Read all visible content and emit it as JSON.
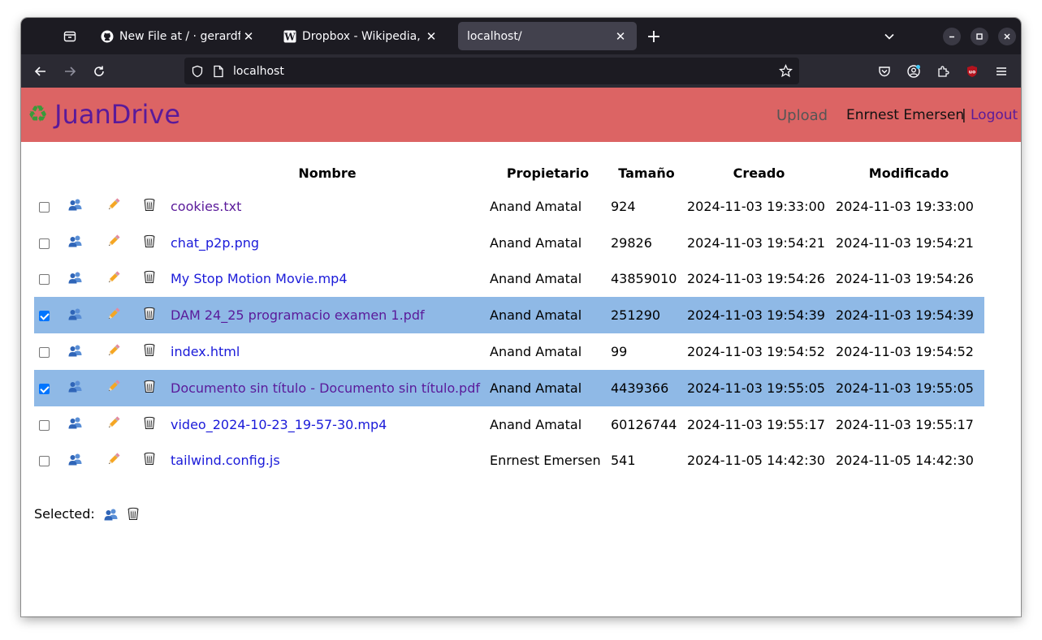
{
  "browser": {
    "tabs": [
      {
        "title": "New File at / · gerardfp/…",
        "favicon": "github-icon",
        "active": false
      },
      {
        "title": "Dropbox - Wikipedia, la e…",
        "favicon": "wikipedia-icon",
        "active": false
      },
      {
        "title": "localhost/",
        "favicon": "none",
        "active": true
      }
    ],
    "url": "localhost"
  },
  "header": {
    "brand": "JuanDrive",
    "brand_icon": "recycle-icon",
    "upload_label": "Upload",
    "user_name": "Enrnest Emersen",
    "separator": "|",
    "logout_label": "Logout",
    "bg_color": "#dc6464",
    "brand_color": "#5a1a9a"
  },
  "table": {
    "columns": {
      "name": "Nombre",
      "owner": "Propietario",
      "size": "Tamaño",
      "created": "Creado",
      "modified": "Modificado"
    },
    "rows": [
      {
        "checked": false,
        "name": "cookies.txt",
        "visited": true,
        "owner": "Anand Amatal",
        "size": "924",
        "created": "2024-11-03 19:33:00",
        "modified": "2024-11-03 19:33:00"
      },
      {
        "checked": false,
        "name": "chat_p2p.png",
        "visited": false,
        "owner": "Anand Amatal",
        "size": "29826",
        "created": "2024-11-03 19:54:21",
        "modified": "2024-11-03 19:54:21"
      },
      {
        "checked": false,
        "name": "My Stop Motion Movie.mp4",
        "visited": false,
        "owner": "Anand Amatal",
        "size": "43859010",
        "created": "2024-11-03 19:54:26",
        "modified": "2024-11-03 19:54:26"
      },
      {
        "checked": true,
        "name": "DAM 24_25 programacio examen 1.pdf",
        "visited": true,
        "owner": "Anand Amatal",
        "size": "251290",
        "created": "2024-11-03 19:54:39",
        "modified": "2024-11-03 19:54:39"
      },
      {
        "checked": false,
        "name": "index.html",
        "visited": false,
        "owner": "Anand Amatal",
        "size": "99",
        "created": "2024-11-03 19:54:52",
        "modified": "2024-11-03 19:54:52"
      },
      {
        "checked": true,
        "name": "Documento sin título - Documento sin título.pdf",
        "visited": true,
        "owner": "Anand Amatal",
        "size": "4439366",
        "created": "2024-11-03 19:55:05",
        "modified": "2024-11-03 19:55:05"
      },
      {
        "checked": false,
        "name": "video_2024-10-23_19-57-30.mp4",
        "visited": false,
        "owner": "Anand Amatal",
        "size": "60126744",
        "created": "2024-11-03 19:55:17",
        "modified": "2024-11-03 19:55:17"
      },
      {
        "checked": false,
        "name": "tailwind.config.js",
        "visited": false,
        "owner": "Enrnest Emersen",
        "size": "541",
        "created": "2024-11-05 14:42:30",
        "modified": "2024-11-05 14:42:30"
      }
    ],
    "selected_row_color": "#8fb9e6",
    "link_color": "#1a1ad9",
    "visited_link_color": "#5a1a9a"
  },
  "selected_bar": {
    "label": "Selected:"
  }
}
